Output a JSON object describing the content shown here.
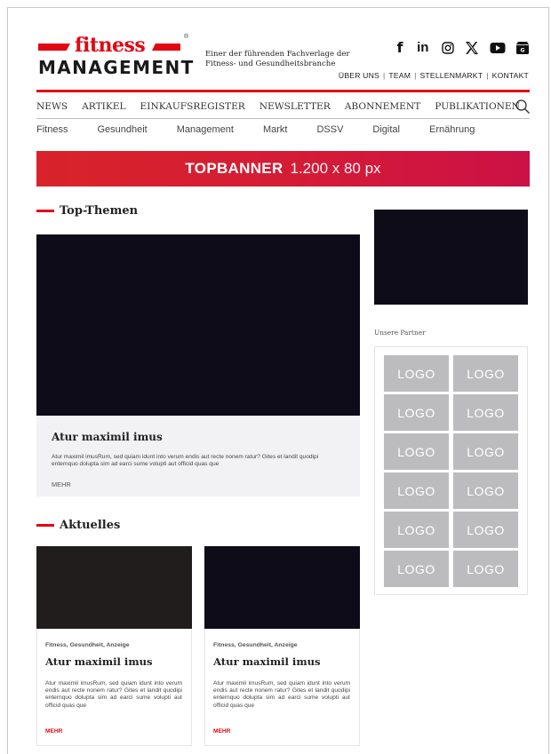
{
  "brand": {
    "word_top": "fitness",
    "word_bottom": "MANAGEMENT",
    "registered": "®",
    "tagline": "Einer der führenden Fachverlage der Fitness- und Gesundheitsbranche"
  },
  "social": {
    "icons": [
      "facebook-icon",
      "linkedin-icon",
      "instagram-icon",
      "x-icon",
      "youtube-icon",
      "store-icon"
    ],
    "facebook": "f",
    "linkedin": "in"
  },
  "toplinks": [
    "ÜBER UNS",
    "TEAM",
    "STELLENMARKT",
    "KONTAKT"
  ],
  "mainnav": [
    "NEWS",
    "ARTIKEL",
    "EINKAUFSREGISTER",
    "NEWSLETTER",
    "ABONNEMENT",
    "PUBLIKATIONEN"
  ],
  "subnav": [
    "Fitness",
    "Gesundheit",
    "Management",
    "Markt",
    "DSSV",
    "Digital",
    "Ernährung"
  ],
  "banner": {
    "label": "TOPBANNER",
    "size": "1.200 x 80 px"
  },
  "top_themen": {
    "heading": "Top-Themen",
    "title": "Atur maximil imus",
    "text": "Atur maximil imusRum, sed quiam idunt into verum endis aut recte nonem ratur? Gites et landit quodipi enternquo dolupta sim ad earci sume volupti aut officid quas que",
    "more": "MEHR"
  },
  "partners": {
    "label": "Unsere Partner",
    "logos": [
      "LOGO",
      "LOGO",
      "LOGO",
      "LOGO",
      "LOGO",
      "LOGO",
      "LOGO",
      "LOGO",
      "LOGO",
      "LOGO",
      "LOGO",
      "LOGO"
    ]
  },
  "aktuelles": {
    "heading": "Aktuelles",
    "cards": [
      {
        "category": "Fitness, Gesundheit, Anzeige",
        "title": "Atur maximil imus",
        "text": "Atur maximil imusRum, sed quiam idunt into verum endis aut recte nonem ratur? Gites et landit quodipi enternquo dolupta sim ad earci sume volupti aut officid quas que",
        "more": "MEHR",
        "image_color": "#211d1d"
      },
      {
        "category": "Fitness, Gesundheit, Anzeige",
        "title": "Atur maximil imus",
        "text": "Atur maximil imusRum, sed quiam idunt into verum endis aut recte nonem ratur? Gites et landit quodipi enternquo dolupta sim ad earci sume volupti aut officid quas que",
        "more": "MEHR",
        "image_color": "#0e0c19"
      }
    ]
  },
  "colors": {
    "accent": "#e30613",
    "dark_image": "#0e0c19",
    "logo_tile": "#bcbcbe"
  }
}
